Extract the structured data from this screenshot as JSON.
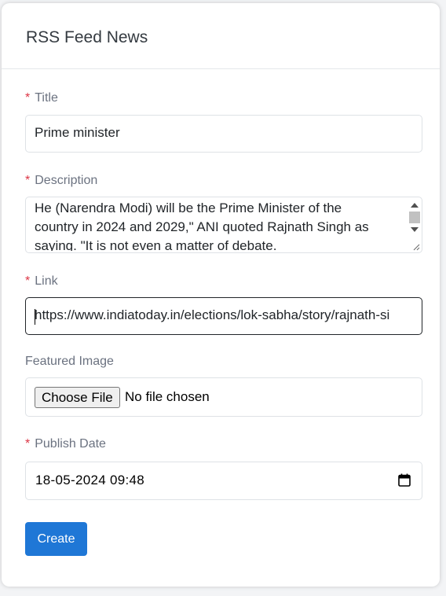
{
  "card": {
    "title": "RSS Feed News"
  },
  "form": {
    "required_marker": "*",
    "title": {
      "label": "Title",
      "value": "Prime minister"
    },
    "description": {
      "label": "Description",
      "lines": [
        "He (Narendra Modi) will be the Prime Minister of the",
        "country in 2024 and 2029,\" ANI quoted Rajnath Singh as",
        "saying. \"It is not even a matter of debate."
      ]
    },
    "link": {
      "label": "Link",
      "value": "https://www.indiatoday.in/elections/lok-sabha/story/rajnath-si"
    },
    "featured_image": {
      "label": "Featured Image",
      "button_label": "Choose File",
      "status": "No file chosen"
    },
    "publish_date": {
      "label": "Publish Date",
      "value": "18-05-2024 09:48"
    },
    "submit_label": "Create"
  },
  "colors": {
    "required": "#dc3545",
    "primary_button": "#1f77d6"
  },
  "icons": {
    "calendar": "calendar-icon",
    "resize": "resize-grip-icon"
  }
}
